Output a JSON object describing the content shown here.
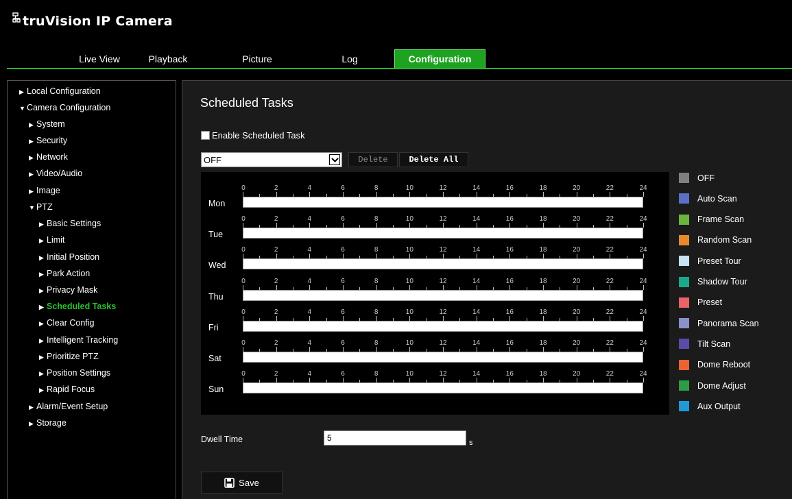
{
  "brand": {
    "title": "truVision IP Camera"
  },
  "nav": {
    "tabs": [
      {
        "label": "Live View"
      },
      {
        "label": "Playback"
      },
      {
        "label": "Picture"
      },
      {
        "label": "Log"
      },
      {
        "label": "Configuration",
        "active": true
      }
    ]
  },
  "sidebar": {
    "items": [
      {
        "label": "Local Configuration",
        "expanded": false
      },
      {
        "label": "Camera Configuration",
        "expanded": true
      },
      {
        "label": "System",
        "expanded": false
      },
      {
        "label": "Security",
        "expanded": false
      },
      {
        "label": "Network",
        "expanded": false
      },
      {
        "label": "Video/Audio",
        "expanded": false
      },
      {
        "label": "Image",
        "expanded": false
      },
      {
        "label": "PTZ",
        "expanded": true
      },
      {
        "label": "Basic Settings",
        "expanded": false
      },
      {
        "label": "Limit",
        "expanded": false
      },
      {
        "label": "Initial Position",
        "expanded": false
      },
      {
        "label": "Park Action",
        "expanded": false
      },
      {
        "label": "Privacy Mask",
        "expanded": false
      },
      {
        "label": "Scheduled Tasks",
        "expanded": false,
        "active": true
      },
      {
        "label": "Clear Config",
        "expanded": false
      },
      {
        "label": "Intelligent Tracking",
        "expanded": false
      },
      {
        "label": "Prioritize PTZ",
        "expanded": false
      },
      {
        "label": "Position Settings",
        "expanded": false
      },
      {
        "label": "Rapid Focus",
        "expanded": false
      },
      {
        "label": "Alarm/Event Setup",
        "expanded": false
      },
      {
        "label": "Storage",
        "expanded": false
      }
    ]
  },
  "main": {
    "title": "Scheduled Tasks",
    "enable_label": "Enable Scheduled Task",
    "enable_checked": false,
    "task_select_value": "OFF",
    "delete_label": "Delete",
    "delete_all_label": "Delete All",
    "hour_ticks": [
      "0",
      "2",
      "4",
      "6",
      "8",
      "10",
      "12",
      "14",
      "16",
      "18",
      "20",
      "22",
      "24"
    ],
    "days": [
      "Mon",
      "Tue",
      "Wed",
      "Thu",
      "Fri",
      "Sat",
      "Sun"
    ],
    "legend": [
      {
        "label": "OFF",
        "color": "#808080"
      },
      {
        "label": "Auto Scan",
        "color": "#5b6fc4"
      },
      {
        "label": "Frame Scan",
        "color": "#6db33f"
      },
      {
        "label": "Random Scan",
        "color": "#e8892c"
      },
      {
        "label": "Preset Tour",
        "color": "#c6e2f3"
      },
      {
        "label": "Shadow Tour",
        "color": "#1aa98a"
      },
      {
        "label": "Preset",
        "color": "#e9646a"
      },
      {
        "label": "Panorama Scan",
        "color": "#8c90c8"
      },
      {
        "label": "Tilt Scan",
        "color": "#5b4aa8"
      },
      {
        "label": "Dome Reboot",
        "color": "#ec6235"
      },
      {
        "label": "Dome Adjust",
        "color": "#2e9b48"
      },
      {
        "label": "Aux Output",
        "color": "#1e9ad6"
      }
    ],
    "dwell_label": "Dwell Time",
    "dwell_value": "5",
    "dwell_unit": "s",
    "save_label": "Save"
  }
}
